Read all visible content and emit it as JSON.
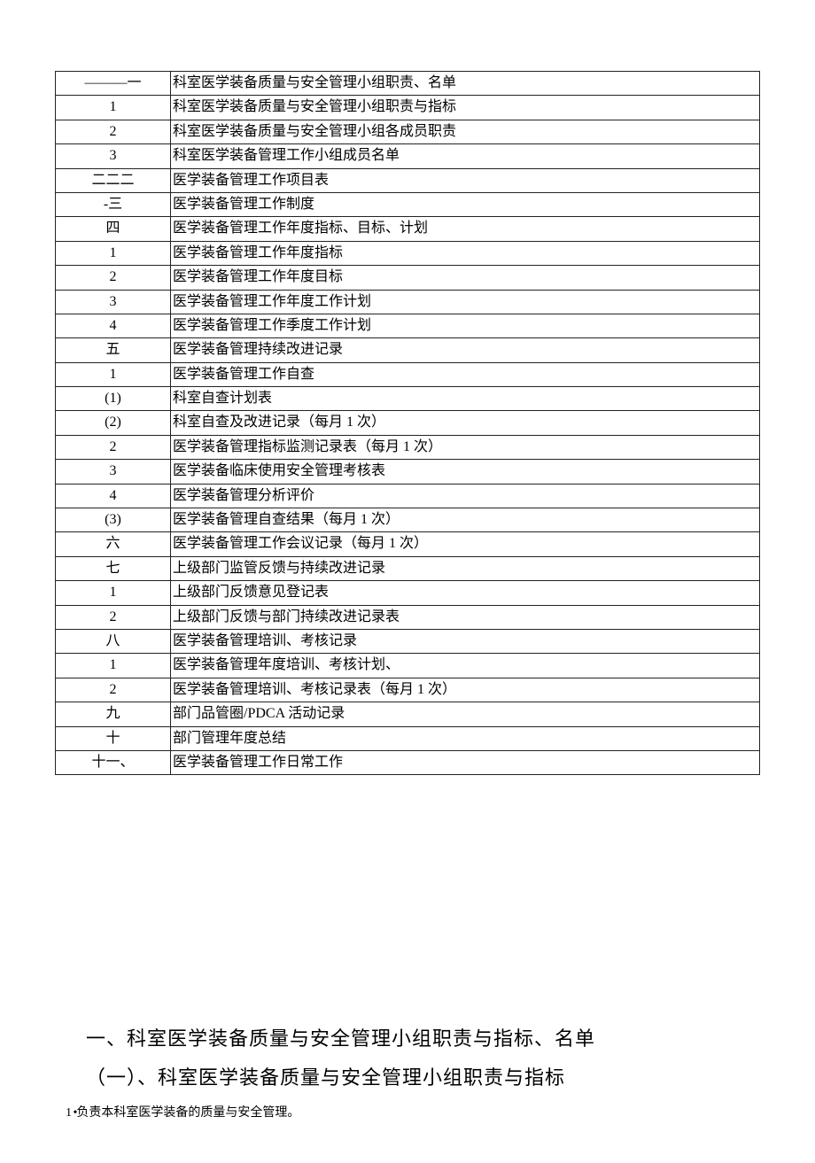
{
  "toc": [
    {
      "num": "———一",
      "desc": "科室医学装备质量与安全管理小组职责、名单"
    },
    {
      "num": "1",
      "desc": "科室医学装备质量与安全管理小组职责与指标"
    },
    {
      "num": "2",
      "desc": "科室医学装备质量与安全管理小组各成员职责"
    },
    {
      "num": "3",
      "desc": "科室医学装备管理工作小组成员名单"
    },
    {
      "num": "二二二",
      "desc": "医学装备管理工作项目表"
    },
    {
      "num": "-三",
      "desc": "医学装备管理工作制度"
    },
    {
      "num": "四",
      "desc": "医学装备管理工作年度指标、目标、计划"
    },
    {
      "num": "1",
      "desc": "医学装备管理工作年度指标"
    },
    {
      "num": "2",
      "desc": "医学装备管理工作年度目标"
    },
    {
      "num": "3",
      "desc": "医学装备管理工作年度工作计划"
    },
    {
      "num": "4",
      "desc": "医学装备管理工作季度工作计划"
    },
    {
      "num": "五",
      "desc": "医学装备管理持续改进记录"
    },
    {
      "num": "1",
      "desc": "医学装备管理工作自查"
    },
    {
      "num": "(1)",
      "desc": "科室自查计划表"
    },
    {
      "num": "(2)",
      "desc": "科室自查及改进记录（每月 1 次）"
    },
    {
      "num": "2",
      "desc": "医学装备管理指标监测记录表（每月 1 次）"
    },
    {
      "num": "3",
      "desc": "医学装备临床使用安全管理考核表"
    },
    {
      "num": "4",
      "desc": "医学装备管理分析评价"
    },
    {
      "num": "(3)",
      "desc": "医学装备管理自查结果（每月 1 次）"
    },
    {
      "num": "六",
      "desc": "医学装备管理工作会议记录（每月 1 次）"
    },
    {
      "num": "七",
      "desc": "上级部门监管反馈与持续改进记录"
    },
    {
      "num": "1",
      "desc": "上级部门反馈意见登记表"
    },
    {
      "num": "2",
      "desc": "上级部门反馈与部门持续改进记录表"
    },
    {
      "num": "八",
      "desc": "医学装备管理培训、考核记录"
    },
    {
      "num": "1",
      "desc": "医学装备管理年度培训、考核计划、"
    },
    {
      "num": "2",
      "desc": "医学装备管理培训、考核记录表（每月 1 次）"
    },
    {
      "num": "九",
      "desc": "部门品管圈/PDCA 活动记录"
    },
    {
      "num": "十",
      "desc": "部门管理年度总结"
    },
    {
      "num": "十一、",
      "desc": "医学装备管理工作日常工作"
    }
  ],
  "section": {
    "h1": "一、科室医学装备质量与安全管理小组职责与指标、名单",
    "h2": "（一）、科室医学装备质量与安全管理小组职责与指标",
    "line1_prefix": "1 •",
    "line1_text": "负责本科室医学装备的质量与安全管理。"
  }
}
